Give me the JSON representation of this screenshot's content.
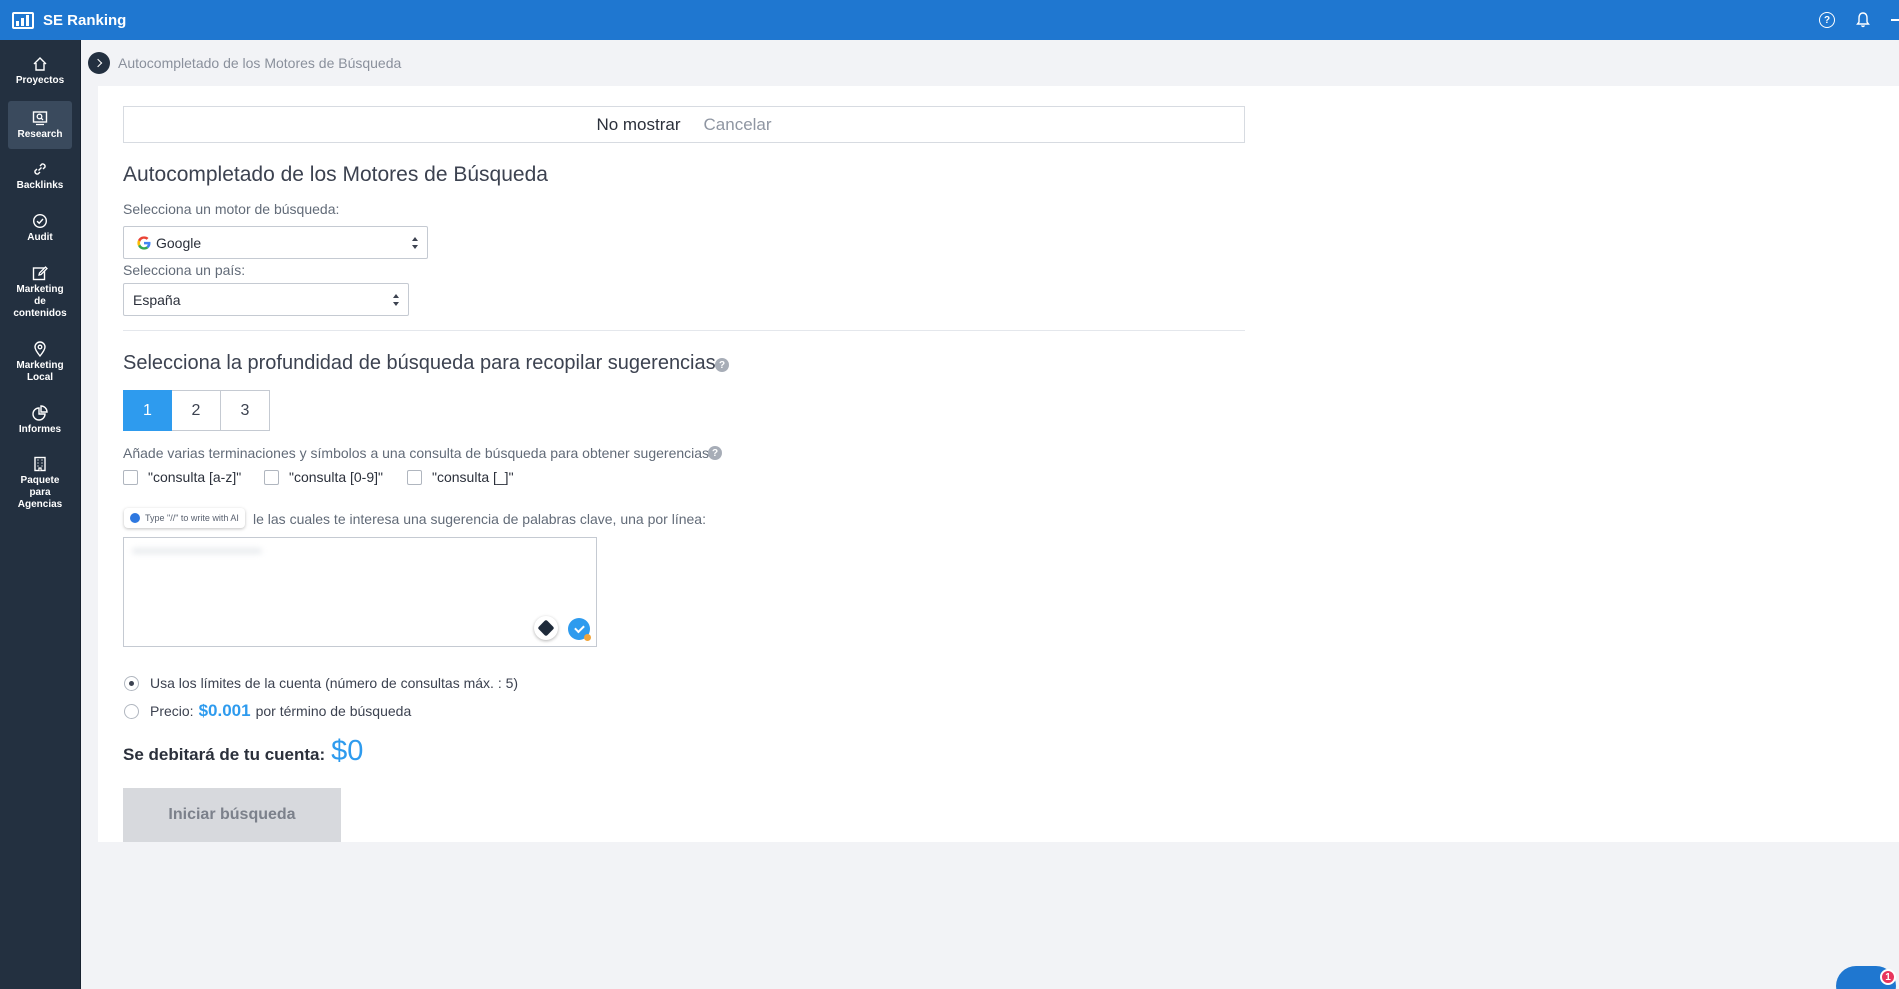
{
  "app": {
    "title": "SE Ranking"
  },
  "sidebar": {
    "items": [
      {
        "label": "Proyectos",
        "icon": "home-icon"
      },
      {
        "label": "Research",
        "icon": "search-icon",
        "active": true
      },
      {
        "label": "Backlinks",
        "icon": "link-icon"
      },
      {
        "label": "Audit",
        "icon": "check-circle-icon"
      },
      {
        "label": "Marketing de contenidos",
        "icon": "edit-icon"
      },
      {
        "label": "Marketing Local",
        "icon": "location-pin-icon"
      },
      {
        "label": "Informes",
        "icon": "pie-chart-icon"
      },
      {
        "label": "Paquete para Agencias",
        "icon": "building-icon"
      }
    ]
  },
  "breadcrumb": {
    "text": "Autocompletado de los Motores de Búsqueda"
  },
  "notice": {
    "dont_show": "No mostrar",
    "cancel": "Cancelar"
  },
  "form": {
    "title": "Autocompletado de los Motores de Búsqueda",
    "engine_label": "Selecciona un motor de búsqueda:",
    "engine_value": "Google",
    "country_label": "Selecciona un país:",
    "country_value": "España",
    "depth_title": "Selecciona la profundidad de búsqueda para recopilar sugerencias",
    "depth_options": [
      "1",
      "2",
      "3"
    ],
    "depth_selected": "1",
    "suffix_label": "Añade varias terminaciones y símbolos a una consulta de búsqueda para obtener sugerencias",
    "suffix_options": [
      "\"consulta [a-z]\"",
      "\"consulta [0-9]\"",
      "\"consulta [_]\""
    ],
    "ai_hint": "Type \"//\" to write with AI",
    "keywords_label": "le las cuales te interesa una sugerencia de palabras clave, una por línea:",
    "radio_limits": "Usa los límites de la cuenta (número de consultas máx. : 5)",
    "radio_price_prefix": "Precio:",
    "radio_price_value": "$0.001",
    "radio_price_suffix": "por término de búsqueda",
    "debit_label": "Se debitará de tu cuenta:",
    "debit_amount": "$0",
    "start_button": "Iniciar búsqueda"
  },
  "chat": {
    "badge": "1"
  },
  "colors": {
    "topbar": "#1f77d0",
    "sidebar": "#233040",
    "accent": "#2e9bee"
  }
}
